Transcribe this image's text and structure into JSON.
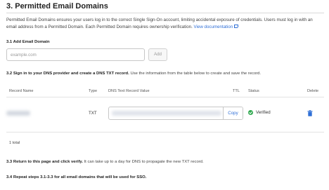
{
  "section": {
    "title": "3. Permitted Email Domains"
  },
  "intro": {
    "text": "Permitted Email Domains ensures your users log in to the correct Single Sign-On account, limiting accidental exposure of credentials. Users must log in with an email address from a Permitted Domain. Each Permitted Domain requires ownership verification.",
    "link_label": "View documentation",
    "link_icon": "external-link-icon"
  },
  "step_add": {
    "heading": "3.1 Add Email Domain",
    "input_placeholder": "example.com",
    "input_value": "",
    "add_label": "Add"
  },
  "step_dns": {
    "heading_bold": "3.2 Sign in to your DNS provider and create a DNS TXT record.",
    "heading_normal": "Use the information from the table below to create and save the record."
  },
  "table": {
    "columns": [
      "Record Name",
      "Type",
      "DNS Text Record Value",
      "TTL",
      "Status",
      "Delete"
    ],
    "rows": [
      {
        "record_name": "",
        "type": "TXT",
        "value": "",
        "copy_label": "Copy",
        "ttl": "",
        "status": "Verified",
        "status_icon": "check-circle-icon",
        "delete_icon": "trash-icon"
      }
    ],
    "total": "1 total"
  },
  "step_return": {
    "heading_bold": "3.3 Return to this page and click verify.",
    "heading_normal": "It can take up to a day for DNS to propagate the new TXT record."
  },
  "step_repeat": {
    "heading_bold": "3.4 Repeat steps 3.1-3.3 for all email domains that will be used for SSO."
  },
  "colors": {
    "link": "#2f6fd6",
    "verified": "#2fa84f",
    "delete": "#2f6fd6"
  }
}
